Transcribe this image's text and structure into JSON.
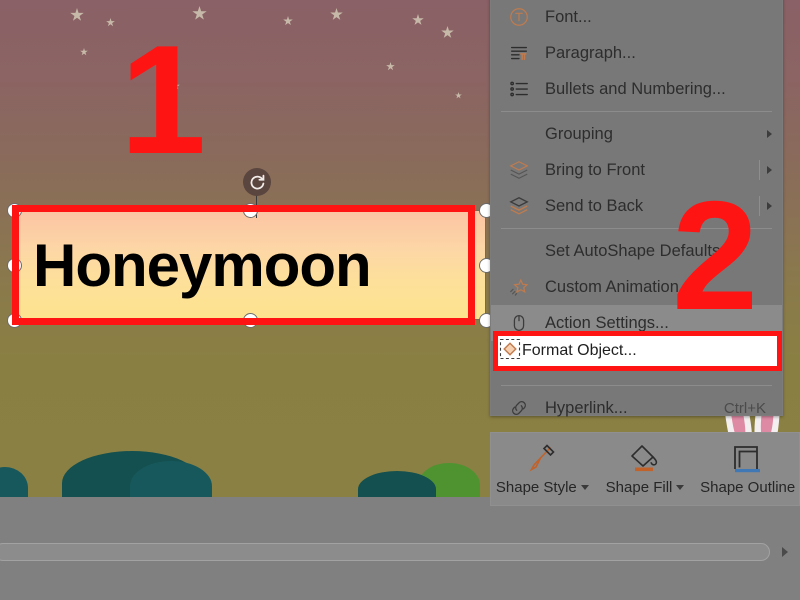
{
  "slide": {
    "textbox": {
      "text": "Honeymoon"
    },
    "rotate_handle_icon": "rotate-icon",
    "bunny_icon": "bunny-illustration"
  },
  "annotations": {
    "step_one": "1",
    "step_two": "2",
    "highlight_color": "#ff1414"
  },
  "context_menu": {
    "items": [
      {
        "label": "Font...",
        "icon": "font-icon",
        "submenu": false,
        "shortcut": "",
        "highlighted": false
      },
      {
        "label": "Paragraph...",
        "icon": "paragraph-icon",
        "submenu": false,
        "shortcut": "",
        "highlighted": false
      },
      {
        "label": "Bullets and Numbering...",
        "icon": "bullets-icon",
        "submenu": false,
        "shortcut": "",
        "highlighted": false
      },
      {
        "label": "Grouping",
        "icon": "",
        "submenu": true,
        "shortcut": "",
        "highlighted": false
      },
      {
        "label": "Bring to Front",
        "icon": "bring-to-front-icon",
        "submenu": true,
        "shortcut": "",
        "highlighted": false
      },
      {
        "label": "Send to Back",
        "icon": "send-to-back-icon",
        "submenu": true,
        "shortcut": "",
        "highlighted": false
      },
      {
        "label": "Set AutoShape Defaults",
        "icon": "",
        "submenu": false,
        "shortcut": "",
        "highlighted": false
      },
      {
        "label": "Custom Animation...",
        "icon": "custom-animation-icon",
        "submenu": false,
        "shortcut": "",
        "highlighted": false
      },
      {
        "label": "Action Settings...",
        "icon": "mouse-icon",
        "submenu": false,
        "shortcut": "",
        "highlighted": true
      },
      {
        "label": "Format Object...",
        "icon": "format-object-icon",
        "submenu": false,
        "shortcut": "",
        "highlighted": false
      },
      {
        "label": "Hyperlink...",
        "icon": "hyperlink-icon",
        "submenu": false,
        "shortcut": "Ctrl+K",
        "highlighted": false
      }
    ]
  },
  "shape_toolbar": {
    "items": [
      {
        "label": "Shape Style",
        "icon": "brush-icon",
        "has_caret": true,
        "accent": "#c0622a"
      },
      {
        "label": "Shape Fill",
        "icon": "paint-bucket-icon",
        "has_caret": true,
        "accent": "#c0622a"
      },
      {
        "label": "Shape Outline",
        "icon": "shape-outline-icon",
        "has_caret": false,
        "accent": "#3f78b5"
      }
    ]
  },
  "scrollbar": {
    "right_arrow_icon": "scroll-right-arrow-icon"
  }
}
